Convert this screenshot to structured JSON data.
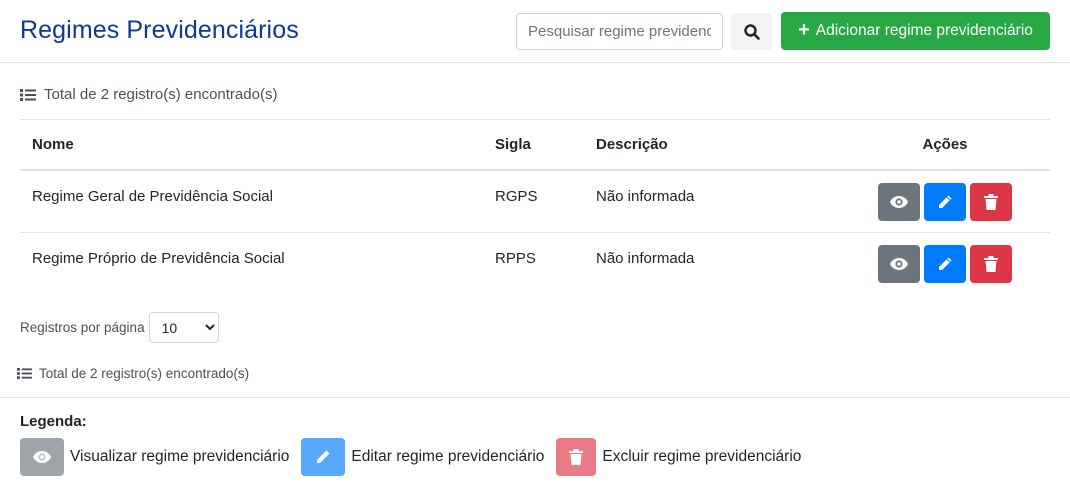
{
  "header": {
    "title": "Regimes Previdenciários",
    "search_placeholder": "Pesquisar regime previdenciário",
    "add_button_label": "Adicionar regime previdenciário"
  },
  "summary": {
    "total_top": "Total de 2 registro(s) encontrado(s)",
    "total_bottom": "Total de 2 registro(s) encontrado(s)"
  },
  "table": {
    "columns": [
      "Nome",
      "Sigla",
      "Descrição",
      "Ações"
    ],
    "rows": [
      {
        "nome": "Regime Geral de Previdência Social",
        "sigla": "RGPS",
        "descricao": "Não informada"
      },
      {
        "nome": "Regime Próprio de Previdência Social",
        "sigla": "RPPS",
        "descricao": "Não informada"
      }
    ]
  },
  "pagination": {
    "per_page_label": "Registros por página",
    "per_page_value": "10"
  },
  "legend": {
    "title": "Legenda:",
    "view_label": "Visualizar regime previdenciário",
    "edit_label": "Editar regime previdenciário",
    "delete_label": "Excluir regime previdenciário"
  },
  "colors": {
    "primary_title": "#0d3b8c",
    "success": "#28a745",
    "secondary": "#6c757d",
    "primary": "#007bff",
    "danger": "#dc3545"
  },
  "icons": {
    "search": "search-icon",
    "add": "plus-icon",
    "list": "list-icon",
    "view": "eye-icon",
    "edit": "pencil-icon",
    "delete": "trash-icon"
  }
}
